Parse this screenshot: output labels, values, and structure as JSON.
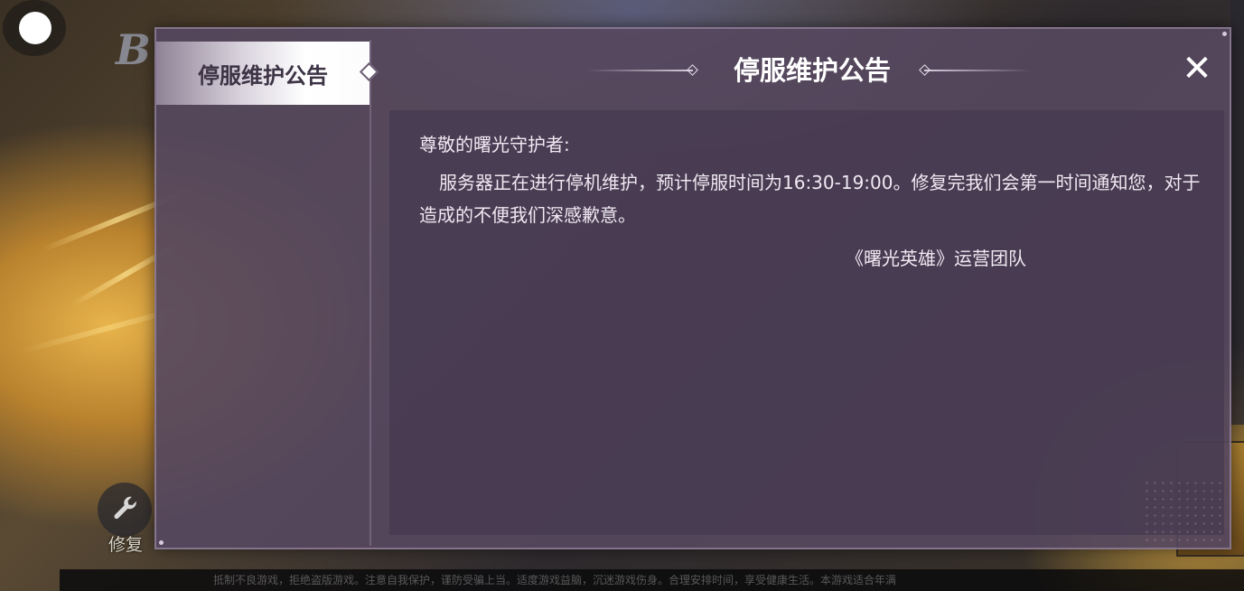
{
  "background": {
    "logo_text": "B",
    "repair_button": {
      "label": "修复",
      "icon": "wrench-icon"
    },
    "bottom_bar_text": "抵制不良游戏，拒绝盗版游戏。注意自我保护，谨防受骗上当。适度游戏益脑，沉迷游戏伤身。合理安排时间，享受健康生活。本游戏适合年满",
    "floating_button_icon": "white-circle-icon"
  },
  "dialog": {
    "sidebar": {
      "tabs": [
        {
          "label": "停服维护公告",
          "active": true
        }
      ]
    },
    "title": "停服维护公告",
    "close_icon": "close-icon",
    "close_symbol": "✕",
    "notice": {
      "greeting": "尊敬的曙光守护者:",
      "body": "服务器正在进行停机维护，预计停服时间为16:30-19:00。修复完我们会第一时间通知您，对于造成的不便我们深感歉意。",
      "signature": "《曙光英雄》运营团队"
    }
  },
  "colors": {
    "dialog_bg": "#56485e",
    "tab_active_bg": "#ffffff",
    "text_light": "#efe9f2",
    "title_text": "#ffffff"
  }
}
